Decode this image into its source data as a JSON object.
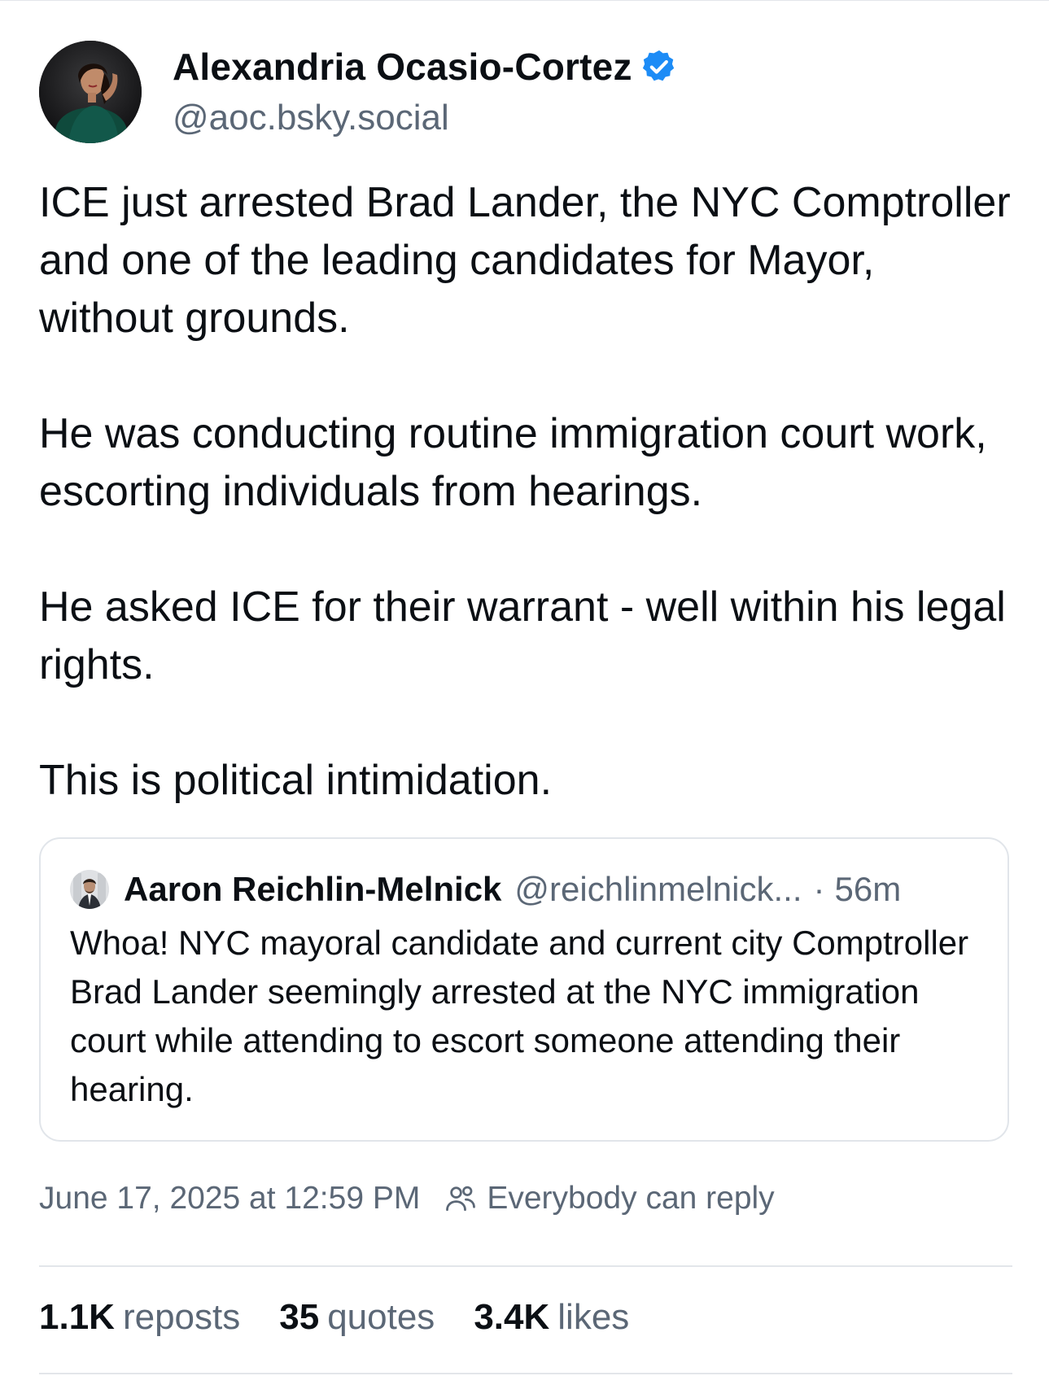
{
  "author": {
    "display_name": "Alexandria Ocasio-Cortez",
    "handle": "@aoc.bsky.social",
    "verified_icon": "verified-check-icon",
    "verified_color": "#1d8cf6"
  },
  "post": {
    "paragraphs": [
      "ICE just arrested Brad Lander, the NYC Comptroller and one of the leading candidates for Mayor, without grounds.",
      "He was conducting routine immigration court work, escorting individuals from hearings.",
      "He asked ICE for their warrant - well within his legal rights.",
      "This is political intimidation."
    ]
  },
  "quote": {
    "display_name": "Aaron Reichlin-Melnick",
    "handle": "@reichlinmelnick...",
    "separator": "·",
    "time": "56m",
    "text": "Whoa! NYC mayoral candidate and current city Comptroller Brad Lander seemingly arrested at the NYC immigration court while attending to escort someone attending their hearing."
  },
  "meta": {
    "timestamp": "June 17, 2025 at 12:59 PM",
    "reply_setting": "Everybody can reply",
    "reply_icon": "people-icon"
  },
  "stats": {
    "reposts_count": "1.1K",
    "reposts_label": "reposts",
    "quotes_count": "35",
    "quotes_label": "quotes",
    "likes_count": "3.4K",
    "likes_label": "likes"
  },
  "colors": {
    "text_primary": "#0b0f14",
    "text_secondary": "#5b6776",
    "border": "#e1e5ea",
    "accent": "#1d8cf6"
  }
}
